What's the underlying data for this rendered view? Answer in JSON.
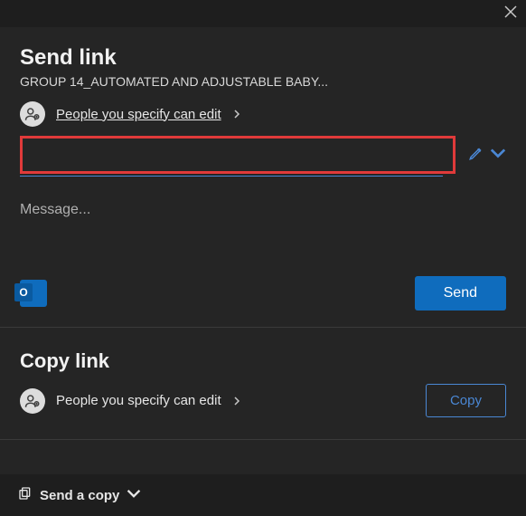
{
  "header": {
    "title": "Send link",
    "subtitle": "GROUP 14_AUTOMATED AND ADJUSTABLE BABY..."
  },
  "permissions": {
    "send_label": "People you specify can edit",
    "copy_label": "People you specify can edit"
  },
  "inputs": {
    "recipients_value": "",
    "message_placeholder": "Message..."
  },
  "buttons": {
    "send": "Send",
    "copy": "Copy",
    "send_a_copy": "Send a copy"
  },
  "sections": {
    "copy_title": "Copy link"
  },
  "icons": {
    "outlook_letter": "O"
  }
}
